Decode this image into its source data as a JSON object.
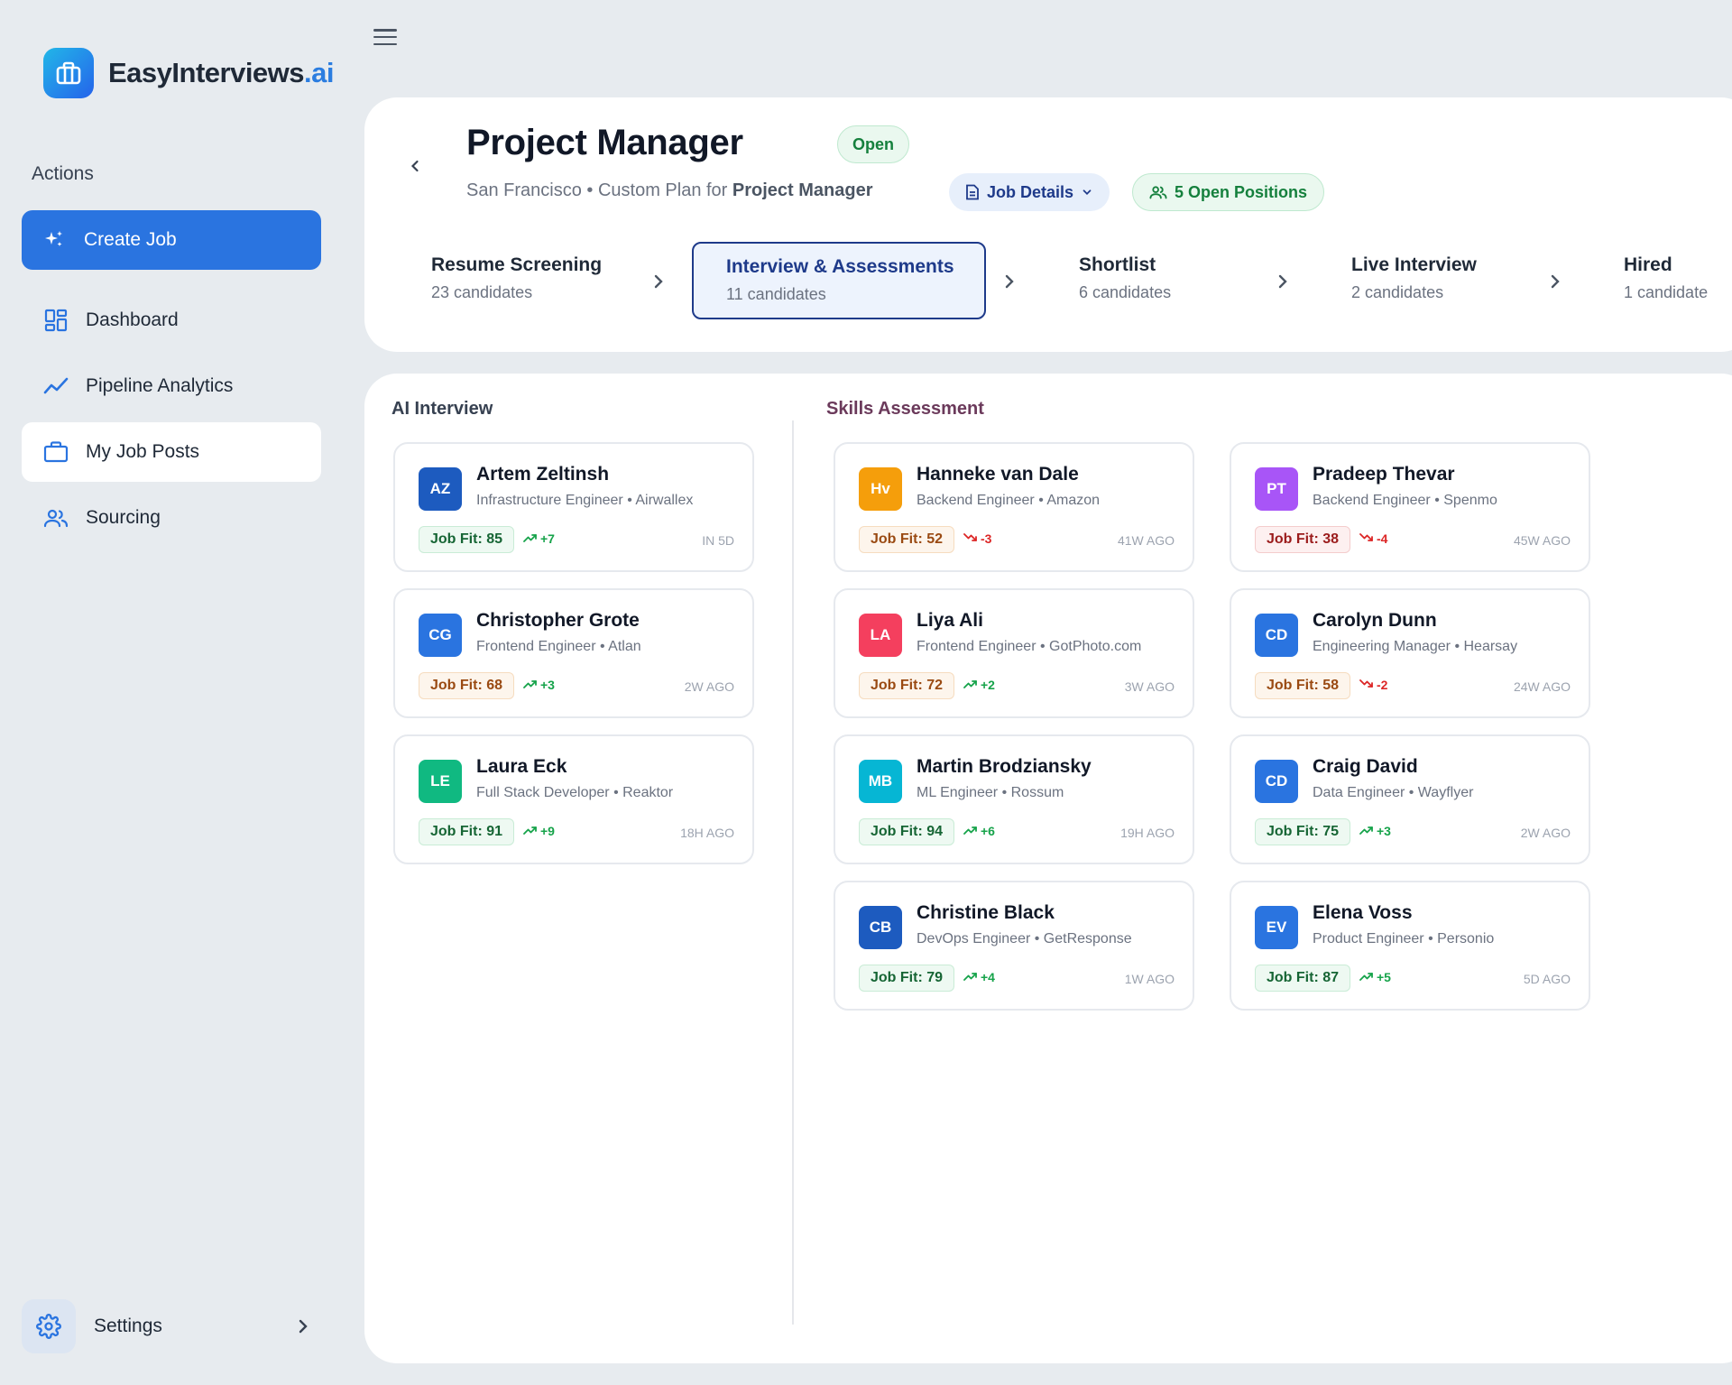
{
  "app": {
    "name": "EasyInterviews",
    "name_suffix": ".ai"
  },
  "sidebar": {
    "section_label": "Actions",
    "create_job": "Create Job",
    "items": [
      {
        "label": "Dashboard",
        "icon": "dashboard-icon"
      },
      {
        "label": "Pipeline Analytics",
        "icon": "analytics-icon"
      },
      {
        "label": "My Job Posts",
        "icon": "briefcase-icon"
      },
      {
        "label": "Sourcing",
        "icon": "users-icon"
      }
    ],
    "settings": "Settings"
  },
  "job": {
    "title": "Project Manager",
    "status": "Open",
    "location_plan": "San Francisco • Custom Plan for ",
    "plan_role": "Project Manager",
    "details_button": "Job Details",
    "open_positions": "5 Open Positions"
  },
  "stages": [
    {
      "name": "Resume Screening",
      "count": "23 candidates"
    },
    {
      "name": "Interview & Assessments",
      "count": "11 candidates"
    },
    {
      "name": "Shortlist",
      "count": "6 candidates"
    },
    {
      "name": "Live Interview",
      "count": "2 candidates"
    },
    {
      "name": "Hired",
      "count": "1 candidate"
    }
  ],
  "colors": {
    "accent": "#2a74e0",
    "active_stage": "#1e3a8a",
    "open_green": "#15803d"
  },
  "columns": {
    "ai_interview": {
      "title": "AI Interview",
      "candidates": [
        {
          "initials": "AZ",
          "name": "Artem Zeltinsh",
          "role": "Infrastructure Engineer • Airwallex",
          "fit": "Job Fit: 85",
          "trend": "+7",
          "when": "IN 5D",
          "color": "#1d5bbf"
        },
        {
          "initials": "CG",
          "name": "Christopher Grote",
          "role": "Frontend Engineer • Atlan",
          "fit": "Job Fit: 68",
          "trend": "+3",
          "when": "2W AGO",
          "color": "#2a74e0"
        },
        {
          "initials": "LE",
          "name": "Laura Eck",
          "role": "Full Stack Developer • Reaktor",
          "fit": "Job Fit: 91",
          "trend": "+9",
          "when": "18H AGO",
          "color": "#10b981"
        }
      ]
    },
    "skills_assessment": {
      "title": "Skills Assessment",
      "candidates": [
        {
          "initials": "Hv",
          "name": "Hanneke van Dale",
          "role": "Backend Engineer • Amazon",
          "fit": "Job Fit: 52",
          "trend": "-3",
          "when": "41W AGO",
          "color": "#f59e0b"
        },
        {
          "initials": "PT",
          "name": "Pradeep Thevar",
          "role": "Backend Engineer • Spenmo",
          "fit": "Job Fit: 38",
          "trend": "-4",
          "when": "45W AGO",
          "color": "#a855f7"
        },
        {
          "initials": "LA",
          "name": "Liya Ali",
          "role": "Frontend Engineer • GotPhoto.com",
          "fit": "Job Fit: 72",
          "trend": "+2",
          "when": "3W AGO",
          "color": "#f43f5e"
        },
        {
          "initials": "CD",
          "name": "Carolyn Dunn",
          "role": "Engineering Manager • Hearsay",
          "fit": "Job Fit: 58",
          "trend": "-2",
          "when": "24W AGO",
          "color": "#2a74e0"
        },
        {
          "initials": "MB",
          "name": "Martin Brodziansky",
          "role": "ML Engineer • Rossum",
          "fit": "Job Fit: 94",
          "trend": "+6",
          "when": "19H AGO",
          "color": "#06b6d4"
        },
        {
          "initials": "CD",
          "name": "Craig David",
          "role": "Data Engineer • Wayflyer",
          "fit": "Job Fit: 75",
          "trend": "+3",
          "when": "2W AGO",
          "color": "#2a74e0"
        },
        {
          "initials": "CB",
          "name": "Christine Black",
          "role": "DevOps Engineer • GetResponse",
          "fit": "Job Fit: 79",
          "trend": "+4",
          "when": "1W AGO",
          "color": "#1d5bbf"
        },
        {
          "initials": "EV",
          "name": "Elena Voss",
          "role": "Product Engineer • Personio",
          "fit": "Job Fit: 87",
          "trend": "+5",
          "when": "5D AGO",
          "color": "#2a74e0"
        }
      ]
    }
  }
}
